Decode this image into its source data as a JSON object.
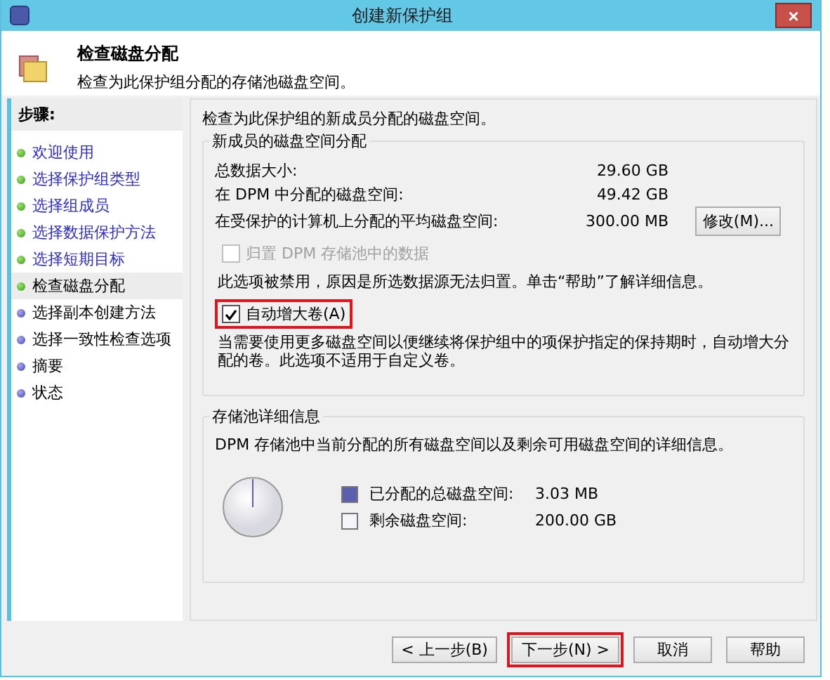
{
  "window": {
    "title": "创建新保护组",
    "close": "×"
  },
  "header": {
    "title": "检查磁盘分配",
    "subtitle": "检查为此保护组分配的存储池磁盘空间。"
  },
  "steps": {
    "heading": "步骤:",
    "items": [
      {
        "label": "欢迎使用",
        "done": true,
        "selected": false
      },
      {
        "label": "选择保护组类型",
        "done": true,
        "selected": false
      },
      {
        "label": "选择组成员",
        "done": true,
        "selected": false
      },
      {
        "label": "选择数据保护方法",
        "done": true,
        "selected": false
      },
      {
        "label": "选择短期目标",
        "done": true,
        "selected": false
      },
      {
        "label": "检查磁盘分配",
        "done": true,
        "selected": true
      },
      {
        "label": "选择副本创建方法",
        "done": false,
        "selected": false
      },
      {
        "label": "选择一致性检查选项",
        "done": false,
        "selected": false
      },
      {
        "label": "摘要",
        "done": false,
        "selected": false
      },
      {
        "label": "状态",
        "done": false,
        "selected": false
      }
    ]
  },
  "intro": "检查为此保护组的新成员分配的磁盘空间。",
  "allocation": {
    "title": "新成员的磁盘空间分配",
    "rows": [
      {
        "label": "总数据大小:",
        "value": "29.60 GB"
      },
      {
        "label": "在 DPM 中分配的磁盘空间:",
        "value": "49.42 GB"
      },
      {
        "label": "在受保护的计算机上分配的平均磁盘空间:",
        "value": "300.00 MB"
      }
    ],
    "modify_button": "修改(M)...",
    "options": [
      {
        "label": "归置 DPM 存储池中的数据",
        "checked": false,
        "disabled": true,
        "highlighted": false,
        "note": "此选项被禁用，原因是所选数据源无法归置。单击“帮助”了解详细信息。"
      },
      {
        "label": "自动增大卷(A)",
        "checked": true,
        "disabled": false,
        "highlighted": true,
        "note": "当需要使用更多磁盘空间以便继续将保护组中的项保护指定的保持期时，自动增大分配的卷。此选项不适用于自定义卷。"
      }
    ]
  },
  "pool": {
    "title": "存储池详细信息",
    "description": "DPM 存储池中当前分配的所有磁盘空间以及剩余可用磁盘空间的详细信息。",
    "legend": [
      {
        "label": "已分配的总磁盘空间:",
        "value": "3.03 MB",
        "color": "#5b5fae"
      },
      {
        "label": "剩余磁盘空间:",
        "value": "200.00 GB",
        "color": "#f4f4fa"
      }
    ]
  },
  "buttons": [
    {
      "label": "< 上一步(B)",
      "highlighted": false
    },
    {
      "label": "下一步(N) >",
      "highlighted": true
    },
    {
      "label": "取消",
      "highlighted": false
    },
    {
      "label": "帮助",
      "highlighted": false
    }
  ]
}
